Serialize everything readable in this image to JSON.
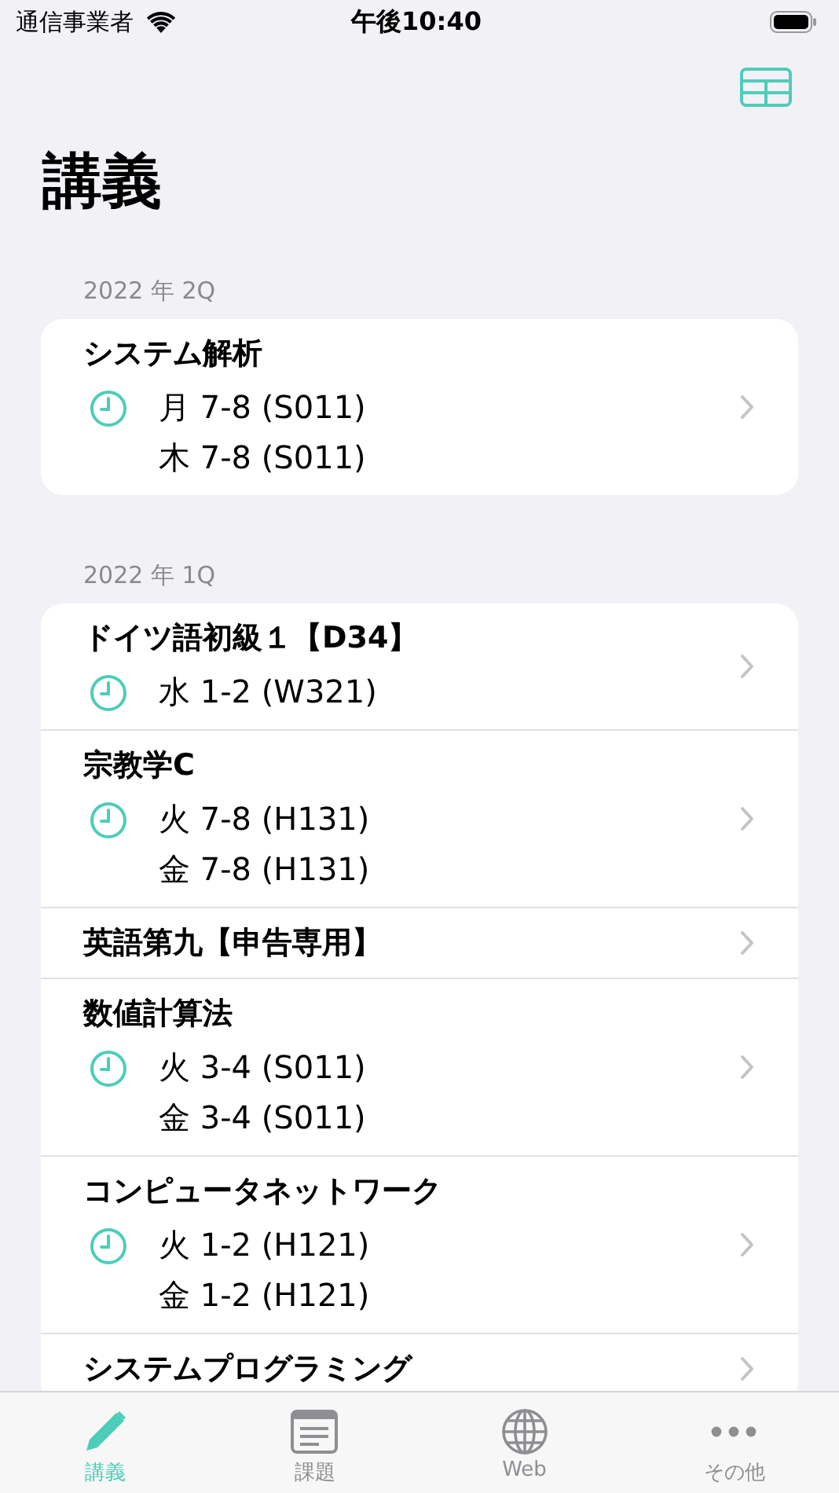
{
  "status_bar": {
    "carrier": "通信事業者",
    "time": "午後10:40"
  },
  "title": "講義",
  "sections": [
    {
      "header": "2022 年 2Q",
      "courses": [
        {
          "title": "システム解析",
          "times": [
            "月 7-8 (S011)",
            "木 7-8 (S011)"
          ]
        }
      ]
    },
    {
      "header": "2022 年 1Q",
      "courses": [
        {
          "title": "ドイツ語初級１【D34】",
          "times": [
            "水 1-2 (W321)"
          ]
        },
        {
          "title": "宗教学C",
          "times": [
            "火 7-8 (H131)",
            "金 7-8 (H131)"
          ]
        },
        {
          "title": "英語第九【申告専用】"
        },
        {
          "title": "数値計算法",
          "times": [
            "火 3-4 (S011)",
            "金 3-4 (S011)"
          ]
        },
        {
          "title": "コンピュータネットワーク",
          "times": [
            "火 1-2 (H121)",
            "金 1-2 (H121)"
          ]
        },
        {
          "title": "システムプログラミング"
        }
      ]
    }
  ],
  "tabs": [
    {
      "label": "講義",
      "kind": "pencil",
      "selected": true
    },
    {
      "label": "課題",
      "kind": "note",
      "selected": false
    },
    {
      "label": "Web",
      "kind": "globe",
      "selected": false
    },
    {
      "label": "その他",
      "kind": "more",
      "selected": false
    }
  ]
}
